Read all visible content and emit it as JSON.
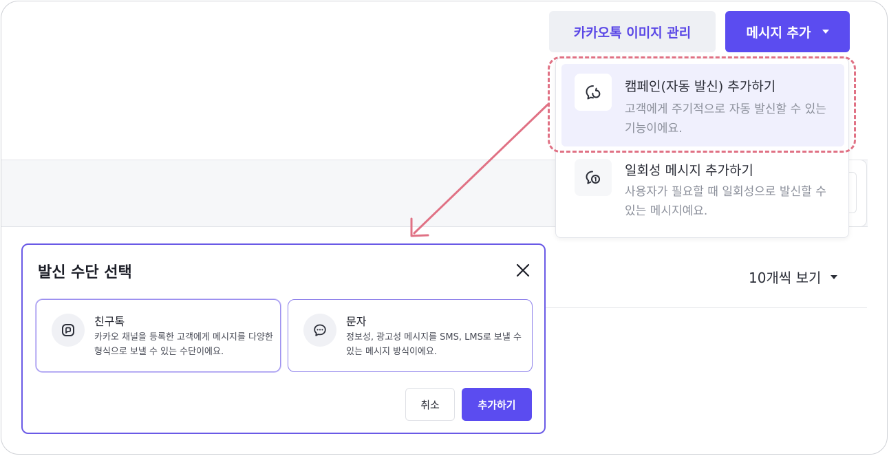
{
  "header": {
    "image_mgmt_label": "카카오톡 이미지 관리",
    "add_message_label": "메시지 추가"
  },
  "dropdown": {
    "items": [
      {
        "title": "캠페인(자동 발신) 추가하기",
        "description": "고객에게 주기적으로 자동 발신할 수 있는 기능이에요.",
        "icon": "campaign-refresh-chat-icon"
      },
      {
        "title": "일회성 메시지 추가하기",
        "description": "사용자가 필요할 때 일회성으로 발신할 수 있는 메시지예요.",
        "icon": "one-time-chat-icon"
      }
    ]
  },
  "list": {
    "page_size_label": "10개씩 보기"
  },
  "modal": {
    "title": "발신 수단 선택",
    "options": [
      {
        "title": "친구톡",
        "description": "카카오 채널을 등록한 고객에게 메시지를 다양한 형식으로 보낼 수 있는 수단이에요.",
        "icon": "friendtalk-icon"
      },
      {
        "title": "문자",
        "description": "정보성, 광고성 메시지를 SMS, LMS로 보낼 수 있는 메시지 방식이에요.",
        "icon": "sms-chat-bubble-icon"
      }
    ],
    "cancel_label": "취소",
    "confirm_label": "추가하기"
  },
  "colors": {
    "brand": "#5b4cf0",
    "highlight": "#e07184",
    "menu_active_bg": "#f0f0fd"
  }
}
